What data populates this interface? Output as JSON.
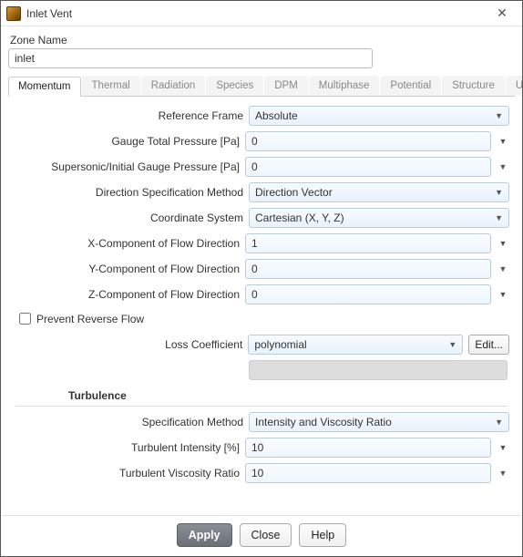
{
  "window": {
    "title": "Inlet Vent"
  },
  "zone": {
    "label": "Zone Name",
    "value": "inlet"
  },
  "tabs": {
    "items": [
      {
        "label": "Momentum"
      },
      {
        "label": "Thermal"
      },
      {
        "label": "Radiation"
      },
      {
        "label": "Species"
      },
      {
        "label": "DPM"
      },
      {
        "label": "Multiphase"
      },
      {
        "label": "Potential"
      },
      {
        "label": "Structure"
      },
      {
        "label": "UDS"
      }
    ],
    "active_index": 0
  },
  "form": {
    "reference_frame": {
      "label": "Reference Frame",
      "value": "Absolute"
    },
    "gauge_total_pressure": {
      "label": "Gauge Total Pressure [Pa]",
      "value": "0"
    },
    "supersonic_pressure": {
      "label": "Supersonic/Initial Gauge Pressure [Pa]",
      "value": "0"
    },
    "direction_method": {
      "label": "Direction Specification Method",
      "value": "Direction Vector"
    },
    "coord_system": {
      "label": "Coordinate System",
      "value": "Cartesian (X, Y, Z)"
    },
    "x_component": {
      "label": "X-Component of Flow Direction",
      "value": "1"
    },
    "y_component": {
      "label": "Y-Component of Flow Direction",
      "value": "0"
    },
    "z_component": {
      "label": "Z-Component of Flow Direction",
      "value": "0"
    },
    "prevent_reverse": {
      "label": "Prevent Reverse Flow",
      "checked": false
    },
    "loss_coeff": {
      "label": "Loss Coefficient",
      "value": "polynomial",
      "edit": "Edit..."
    }
  },
  "turbulence": {
    "title": "Turbulence",
    "spec_method": {
      "label": "Specification Method",
      "value": "Intensity and Viscosity Ratio"
    },
    "intensity": {
      "label": "Turbulent Intensity [%]",
      "value": "10"
    },
    "viscosity_ratio": {
      "label": "Turbulent Viscosity Ratio",
      "value": "10"
    }
  },
  "footer": {
    "apply": "Apply",
    "close": "Close",
    "help": "Help"
  }
}
